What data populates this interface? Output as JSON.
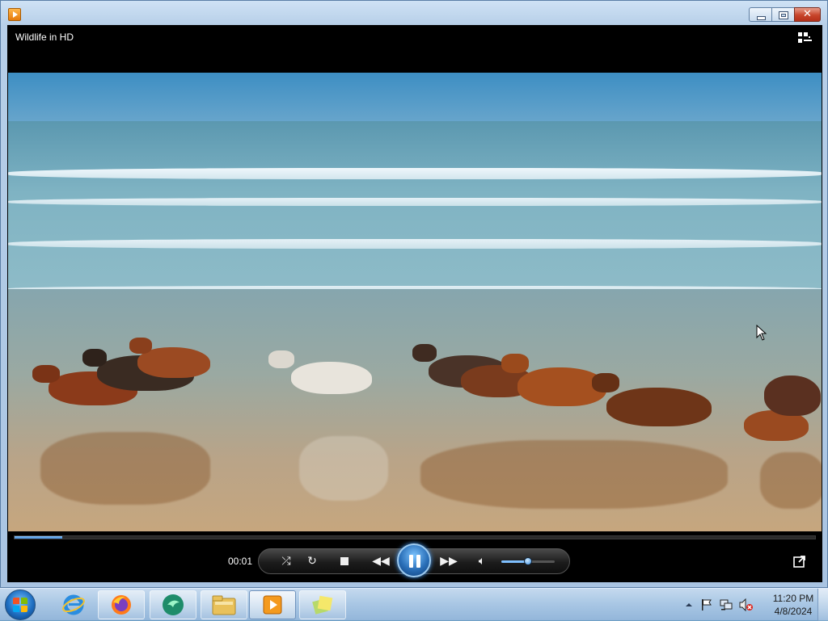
{
  "window": {
    "app_icon": "media-player-icon",
    "caption_buttons": {
      "minimize": "minimize-icon",
      "maximize": "maximize-icon",
      "close": "close-icon"
    }
  },
  "player": {
    "video_title": "Wildlife in HD",
    "switch_to_library_icon": "switch-to-library-icon",
    "time_elapsed": "00:01",
    "seek_progress": 0.06,
    "volume_level": 0.5,
    "controls": [
      "shuffle-icon",
      "repeat-icon",
      "stop-icon",
      "previous-icon",
      "pause-icon",
      "next-icon",
      "volume-icon"
    ],
    "fullscreen_icon": "fullscreen-icon",
    "video_subject": "horses-running-on-beach"
  },
  "taskbar": {
    "start": "windows-start-orb",
    "pinned": [
      "internet-explorer-icon",
      "firefox-icon",
      "green-app-icon",
      "file-explorer-icon",
      "windows-media-player-icon",
      "sticky-notes-icon"
    ],
    "tray_icons": [
      "show-hidden-icons-chevron",
      "action-center-flag-icon",
      "network-icon",
      "volume-muted-icon"
    ],
    "clock": {
      "time": "11:20 PM",
      "date": "4/8/2024"
    }
  }
}
